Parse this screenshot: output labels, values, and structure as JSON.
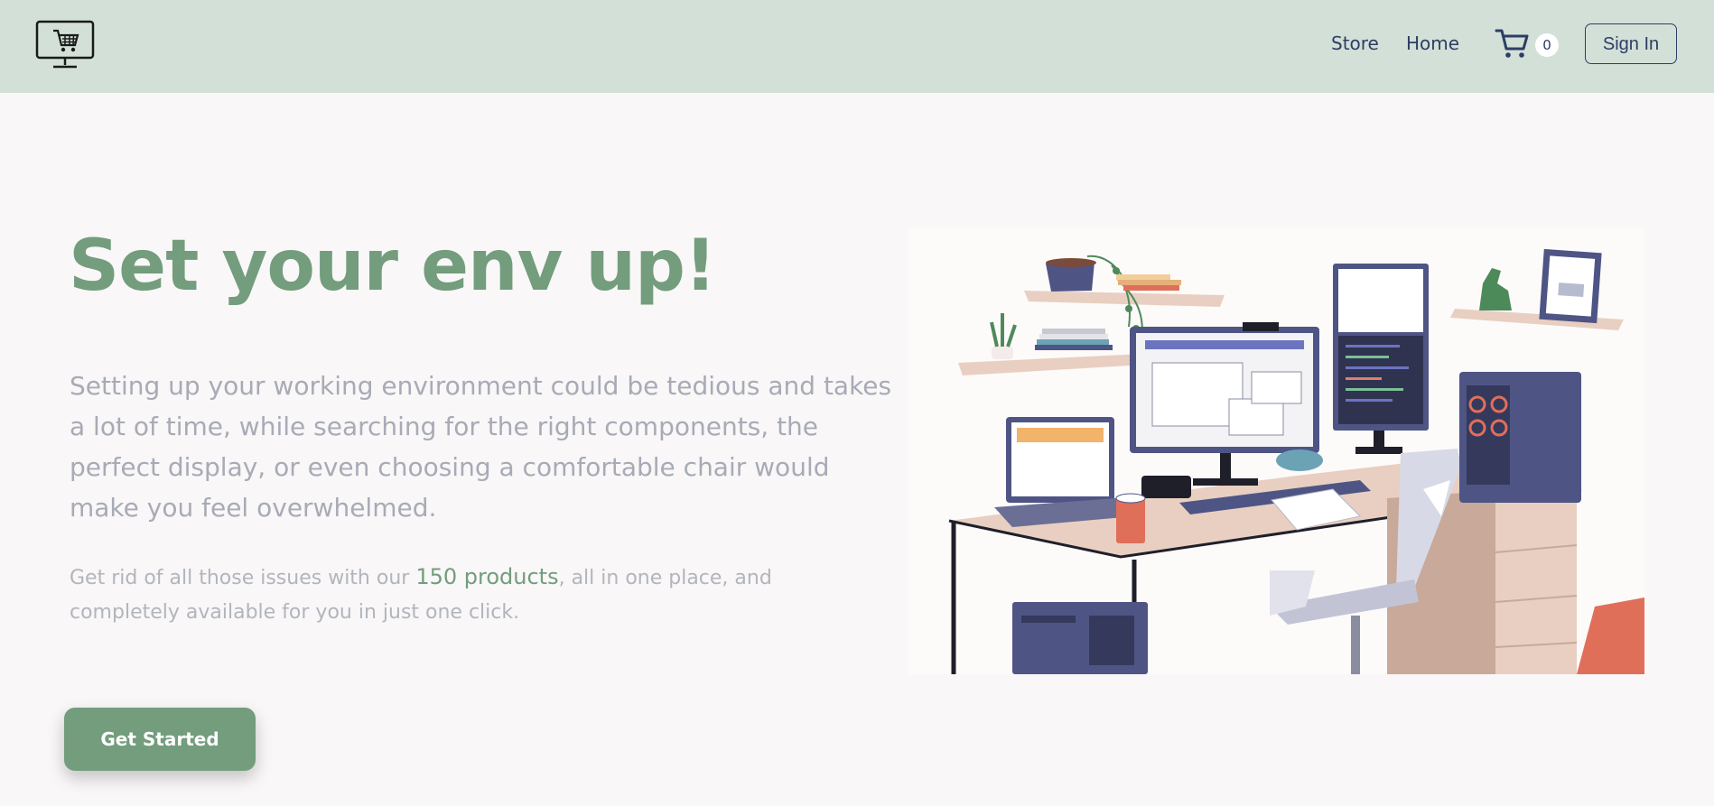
{
  "navbar": {
    "logo_icon": "computer-cart-icon",
    "links": [
      "Store",
      "Home"
    ],
    "cart": {
      "icon": "cart-icon",
      "count": "0"
    },
    "signin_label": "Sign In"
  },
  "hero": {
    "title": "Set your env up!",
    "description": "Setting up your working environment could be tedious and takes a lot of time, while searching for the right components, the perfect display, or even choosing a comfortable chair would make you feel overwhelmed.",
    "sub_before": "Get rid of all those issues with our ",
    "sub_highlight": "150 products",
    "sub_after": ", all in one place, and completely available for you in just one click.",
    "cta_label": "Get Started",
    "illustration": "desk-workspace-illustration"
  },
  "colors": {
    "navbar_bg": "#d3e0d8",
    "accent": "#739d7d",
    "nav_text": "#2c3e63",
    "page_bg": "#f9f7f7"
  }
}
